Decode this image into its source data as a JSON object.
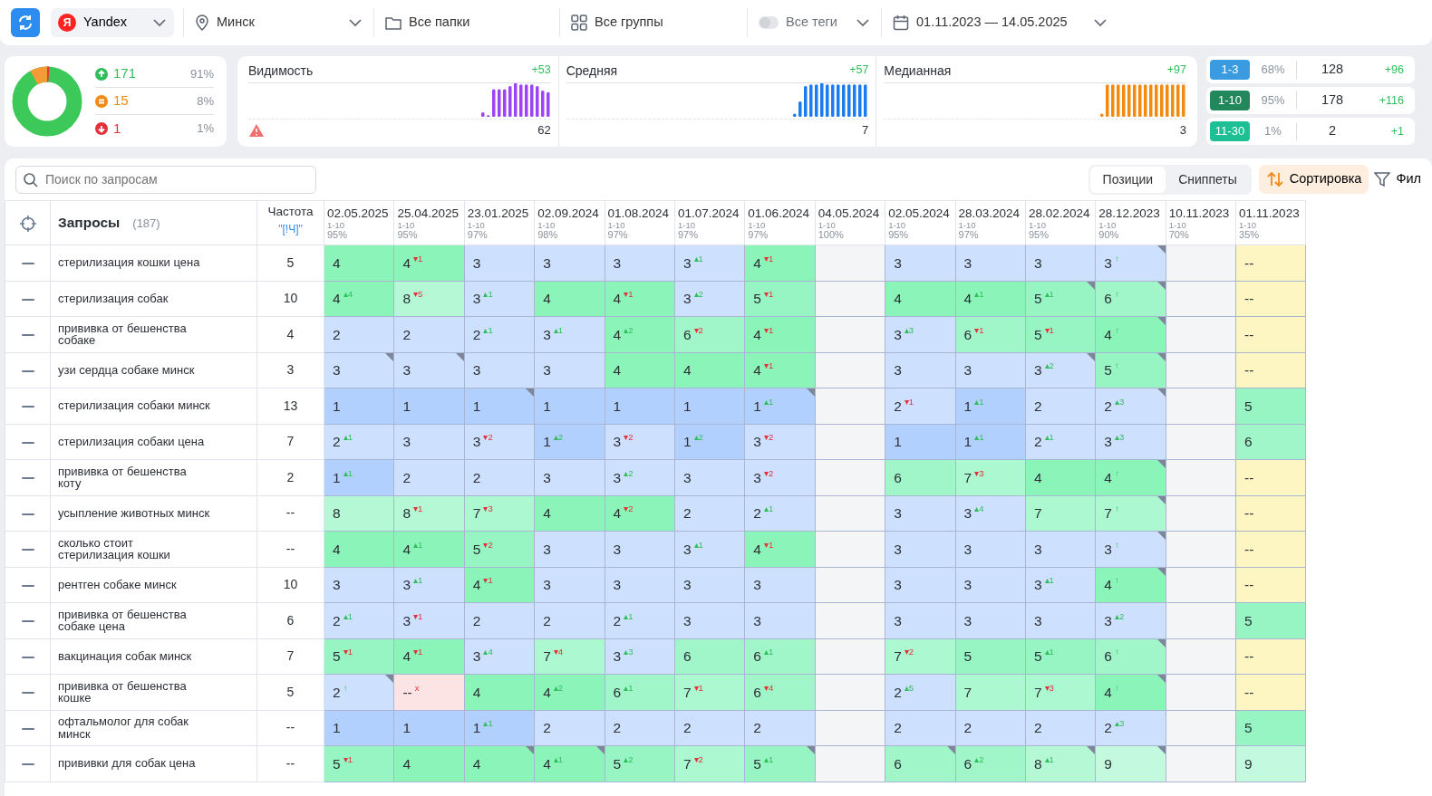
{
  "topbar": {
    "engine": {
      "logo": "Я",
      "label": "Yandex"
    },
    "region": {
      "label": "Минск"
    },
    "folders": {
      "label": "Все папки"
    },
    "groups": {
      "label": "Все группы"
    },
    "tags": {
      "label": "Все теги",
      "on": false
    },
    "dates": {
      "label": "01.11.2023 — 14.05.2025"
    }
  },
  "summary": [
    {
      "kind": "up",
      "count": "171",
      "share": "91%"
    },
    {
      "kind": "equal",
      "count": "15",
      "share": "8%"
    },
    {
      "kind": "down",
      "count": "1",
      "share": "1%"
    }
  ],
  "metrics": [
    {
      "title": "Видимость",
      "delta": "+53",
      "value": "62",
      "warning": true,
      "color": "#9b45f5"
    },
    {
      "title": "Средняя",
      "delta": "+57",
      "value": "7",
      "warning": false,
      "color": "#1a7cf0"
    },
    {
      "title": "Медианная",
      "delta": "+97",
      "value": "3",
      "warning": false,
      "color": "#f28a12"
    }
  ],
  "ranges": [
    {
      "label": "1-3",
      "color": "#3a9be0",
      "share": "68%",
      "count": "128",
      "delta": "+96"
    },
    {
      "label": "1-10",
      "color": "#22885c",
      "share": "95%",
      "count": "178",
      "delta": "+116"
    },
    {
      "label": "11-30",
      "color": "#1dbf95",
      "share": "1%",
      "count": "2",
      "delta": "+1"
    }
  ],
  "search": {
    "placeholder": "Поиск по запросам"
  },
  "view_tabs": [
    {
      "label": "Позиции",
      "selected": true
    },
    {
      "label": "Сниппеты",
      "selected": false
    }
  ],
  "sort_button": "Сортировка",
  "filter_button": "Фил",
  "table": {
    "query_header": "Запросы",
    "query_count": "(187)",
    "freq_header": "Частота",
    "freq_link": "\"[!Ч]\"",
    "columns": [
      {
        "date": "02.05.2025",
        "range": "1-10",
        "share": "95%"
      },
      {
        "date": "25.04.2025",
        "range": "1-10",
        "share": "95%"
      },
      {
        "date": "23.01.2025",
        "range": "1-10",
        "share": "97%"
      },
      {
        "date": "02.09.2024",
        "range": "1-10",
        "share": "98%"
      },
      {
        "date": "01.08.2024",
        "range": "1-10",
        "share": "97%"
      },
      {
        "date": "01.07.2024",
        "range": "1-10",
        "share": "97%"
      },
      {
        "date": "01.06.2024",
        "range": "1-10",
        "share": "97%"
      },
      {
        "date": "04.05.2024",
        "range": "1-10",
        "share": "100%"
      },
      {
        "date": "02.05.2024",
        "range": "1-10",
        "share": "95%"
      },
      {
        "date": "28.03.2024",
        "range": "1-10",
        "share": "97%"
      },
      {
        "date": "28.02.2024",
        "range": "1-10",
        "share": "95%"
      },
      {
        "date": "28.12.2023",
        "range": "1-10",
        "share": "90%"
      },
      {
        "date": "10.11.2023",
        "range": "1-10",
        "share": "70%"
      },
      {
        "date": "01.11.2023",
        "range": "1-10",
        "share": "35%"
      }
    ],
    "rows": [
      {
        "query": "стерилизация кошки цена",
        "freq": "5",
        "cells": [
          {
            "value": "4"
          },
          {
            "value": "4",
            "change": "▾1",
            "kind": "down"
          },
          {
            "value": "3"
          },
          {
            "value": "3"
          },
          {
            "value": "3"
          },
          {
            "value": "3",
            "change": "▴1",
            "kind": "up"
          },
          {
            "value": "4",
            "change": "▾1",
            "kind": "down"
          },
          null,
          {
            "value": "3"
          },
          {
            "value": "3"
          },
          {
            "value": "3"
          },
          {
            "value": "3",
            "change": "↑",
            "kind": "new",
            "marked": true
          },
          null,
          {
            "value": "--"
          }
        ]
      },
      {
        "query": "стерилизация собак",
        "freq": "10",
        "cells": [
          {
            "value": "4",
            "change": "▴4",
            "kind": "up"
          },
          {
            "value": "8",
            "change": "▾5",
            "kind": "down"
          },
          {
            "value": "3",
            "change": "▴1",
            "kind": "up"
          },
          {
            "value": "4"
          },
          {
            "value": "4",
            "change": "▾1",
            "kind": "down"
          },
          {
            "value": "3",
            "change": "▴2",
            "kind": "up"
          },
          {
            "value": "5",
            "change": "▾1",
            "kind": "down"
          },
          null,
          {
            "value": "4"
          },
          {
            "value": "4",
            "change": "▴1",
            "kind": "up"
          },
          {
            "value": "5",
            "change": "▴1",
            "kind": "up",
            "marked": true
          },
          {
            "value": "6",
            "change": "↑",
            "kind": "new",
            "marked": true
          },
          null,
          {
            "value": "--"
          }
        ]
      },
      {
        "query": "прививка от бешенства собаке",
        "freq": "4",
        "cells": [
          {
            "value": "2"
          },
          {
            "value": "2"
          },
          {
            "value": "2",
            "change": "▴1",
            "kind": "up"
          },
          {
            "value": "3",
            "change": "▴1",
            "kind": "up"
          },
          {
            "value": "4",
            "change": "▴2",
            "kind": "up"
          },
          {
            "value": "6",
            "change": "▾2",
            "kind": "down"
          },
          {
            "value": "4",
            "change": "▾1",
            "kind": "down"
          },
          null,
          {
            "value": "3",
            "change": "▴3",
            "kind": "up"
          },
          {
            "value": "6",
            "change": "▾1",
            "kind": "down"
          },
          {
            "value": "5",
            "change": "▾1",
            "kind": "down"
          },
          {
            "value": "4",
            "change": "↑",
            "kind": "new",
            "marked": true
          },
          null,
          {
            "value": "--"
          }
        ]
      },
      {
        "query": "узи сердца собаке минск",
        "freq": "3",
        "cells": [
          {
            "value": "3",
            "marked": true
          },
          {
            "value": "3",
            "marked": true
          },
          {
            "value": "3"
          },
          {
            "value": "3"
          },
          {
            "value": "4"
          },
          {
            "value": "4"
          },
          {
            "value": "4",
            "change": "▾1",
            "kind": "down"
          },
          null,
          {
            "value": "3"
          },
          {
            "value": "3"
          },
          {
            "value": "3",
            "change": "▴2",
            "kind": "up",
            "marked": true
          },
          {
            "value": "5",
            "change": "↑",
            "kind": "new",
            "marked": true
          },
          null,
          {
            "value": "--"
          }
        ]
      },
      {
        "query": "стерилизация собаки минск",
        "freq": "13",
        "cells": [
          {
            "value": "1"
          },
          {
            "value": "1"
          },
          {
            "value": "1",
            "marked": true
          },
          {
            "value": "1"
          },
          {
            "value": "1"
          },
          {
            "value": "1"
          },
          {
            "value": "1",
            "change": "▴1",
            "kind": "up",
            "marked": true
          },
          null,
          {
            "value": "2",
            "change": "▾1",
            "kind": "down"
          },
          {
            "value": "1",
            "change": "▴1",
            "kind": "up"
          },
          {
            "value": "2"
          },
          {
            "value": "2",
            "change": "▴3",
            "kind": "up",
            "marked": true
          },
          null,
          {
            "value": "5"
          }
        ]
      },
      {
        "query": "стерилизация собаки цена",
        "freq": "7",
        "cells": [
          {
            "value": "2",
            "change": "▴1",
            "kind": "up"
          },
          {
            "value": "3"
          },
          {
            "value": "3",
            "change": "▾2",
            "kind": "down"
          },
          {
            "value": "1",
            "change": "▴2",
            "kind": "up"
          },
          {
            "value": "3",
            "change": "▾2",
            "kind": "down"
          },
          {
            "value": "1",
            "change": "▴2",
            "kind": "up"
          },
          {
            "value": "3",
            "change": "▾2",
            "kind": "down"
          },
          null,
          {
            "value": "1"
          },
          {
            "value": "1",
            "change": "▴1",
            "kind": "up"
          },
          {
            "value": "2",
            "change": "▴1",
            "kind": "up"
          },
          {
            "value": "3",
            "change": "▴3",
            "kind": "up"
          },
          null,
          {
            "value": "6"
          }
        ]
      },
      {
        "query": "прививка от бешенства коту",
        "freq": "2",
        "cells": [
          {
            "value": "1",
            "change": "▴1",
            "kind": "up"
          },
          {
            "value": "2"
          },
          {
            "value": "2"
          },
          {
            "value": "3"
          },
          {
            "value": "3",
            "change": "▴2",
            "kind": "up"
          },
          {
            "value": "3"
          },
          {
            "value": "3",
            "change": "▾2",
            "kind": "down"
          },
          null,
          {
            "value": "6"
          },
          {
            "value": "7",
            "change": "▾3",
            "kind": "down"
          },
          {
            "value": "4"
          },
          {
            "value": "4",
            "change": "↑",
            "kind": "new",
            "marked": true
          },
          null,
          {
            "value": "--"
          }
        ]
      },
      {
        "query": "усыпление животных минск",
        "freq": "--",
        "cells": [
          {
            "value": "8"
          },
          {
            "value": "8",
            "change": "▾1",
            "kind": "down"
          },
          {
            "value": "7",
            "change": "▾3",
            "kind": "down"
          },
          {
            "value": "4"
          },
          {
            "value": "4",
            "change": "▾2",
            "kind": "down"
          },
          {
            "value": "2"
          },
          {
            "value": "2",
            "change": "▴1",
            "kind": "up"
          },
          null,
          {
            "value": "3"
          },
          {
            "value": "3",
            "change": "▴4",
            "kind": "up"
          },
          {
            "value": "7"
          },
          {
            "value": "7",
            "change": "↑",
            "kind": "new",
            "marked": true
          },
          null,
          {
            "value": "--"
          }
        ]
      },
      {
        "query": "сколько стоит стерилизация кошки",
        "freq": "--",
        "cells": [
          {
            "value": "4"
          },
          {
            "value": "4",
            "change": "▴1",
            "kind": "up"
          },
          {
            "value": "5",
            "change": "▾2",
            "kind": "down"
          },
          {
            "value": "3"
          },
          {
            "value": "3"
          },
          {
            "value": "3",
            "change": "▴1",
            "kind": "up"
          },
          {
            "value": "4",
            "change": "▾1",
            "kind": "down"
          },
          null,
          {
            "value": "3"
          },
          {
            "value": "3"
          },
          {
            "value": "3"
          },
          {
            "value": "3",
            "change": "↑",
            "kind": "new",
            "marked": true
          },
          null,
          {
            "value": "--"
          }
        ]
      },
      {
        "query": "рентген собаке минск",
        "freq": "10",
        "cells": [
          {
            "value": "3"
          },
          {
            "value": "3",
            "change": "▴1",
            "kind": "up"
          },
          {
            "value": "4",
            "change": "▾1",
            "kind": "down"
          },
          {
            "value": "3"
          },
          {
            "value": "3"
          },
          {
            "value": "3"
          },
          {
            "value": "3"
          },
          null,
          {
            "value": "3"
          },
          {
            "value": "3"
          },
          {
            "value": "3",
            "change": "▴1",
            "kind": "up"
          },
          {
            "value": "4",
            "change": "↑",
            "kind": "new",
            "marked": true
          },
          null,
          {
            "value": "--"
          }
        ]
      },
      {
        "query": "прививка от бешенства собаке цена",
        "freq": "6",
        "cells": [
          {
            "value": "2",
            "change": "▴1",
            "kind": "up"
          },
          {
            "value": "3",
            "change": "▾1",
            "kind": "down"
          },
          {
            "value": "2"
          },
          {
            "value": "2"
          },
          {
            "value": "2",
            "change": "▴1",
            "kind": "up"
          },
          {
            "value": "3"
          },
          {
            "value": "3"
          },
          null,
          {
            "value": "3"
          },
          {
            "value": "3"
          },
          {
            "value": "3"
          },
          {
            "value": "3",
            "change": "▴2",
            "kind": "up"
          },
          null,
          {
            "value": "5"
          }
        ]
      },
      {
        "query": "вакцинация собак минск",
        "freq": "7",
        "cells": [
          {
            "value": "5",
            "change": "▾1",
            "kind": "down"
          },
          {
            "value": "4",
            "change": "▾1",
            "kind": "down"
          },
          {
            "value": "3",
            "change": "▴4",
            "kind": "up"
          },
          {
            "value": "7",
            "change": "▾4",
            "kind": "down"
          },
          {
            "value": "3",
            "change": "▴3",
            "kind": "up"
          },
          {
            "value": "6"
          },
          {
            "value": "6",
            "change": "▴1",
            "kind": "up"
          },
          null,
          {
            "value": "7",
            "change": "▾2",
            "kind": "down"
          },
          {
            "value": "5"
          },
          {
            "value": "5",
            "change": "▴1",
            "kind": "up"
          },
          {
            "value": "6",
            "change": "↑",
            "kind": "new",
            "marked": true
          },
          null,
          {
            "value": "--"
          }
        ]
      },
      {
        "query": "прививка от бешенства кошке",
        "freq": "5",
        "cells": [
          {
            "value": "2",
            "change": "↑",
            "kind": "new",
            "marked": true
          },
          {
            "value": "--",
            "change": "x",
            "kind": "lost"
          },
          {
            "value": "4"
          },
          {
            "value": "4",
            "change": "▴2",
            "kind": "up"
          },
          {
            "value": "6",
            "change": "▴1",
            "kind": "up"
          },
          {
            "value": "7",
            "change": "▾1",
            "kind": "down"
          },
          {
            "value": "6",
            "change": "▾4",
            "kind": "down"
          },
          null,
          {
            "value": "2",
            "change": "▴5",
            "kind": "up"
          },
          {
            "value": "7"
          },
          {
            "value": "7",
            "change": "▾3",
            "kind": "down"
          },
          {
            "value": "4",
            "change": "↑",
            "kind": "new",
            "marked": true
          },
          null,
          {
            "value": "--"
          }
        ]
      },
      {
        "query": "офтальмолог для собак минск",
        "freq": "--",
        "cells": [
          {
            "value": "1"
          },
          {
            "value": "1"
          },
          {
            "value": "1",
            "change": "▴1",
            "kind": "up"
          },
          {
            "value": "2"
          },
          {
            "value": "2"
          },
          {
            "value": "2"
          },
          {
            "value": "2"
          },
          null,
          {
            "value": "2"
          },
          {
            "value": "2"
          },
          {
            "value": "2"
          },
          {
            "value": "2",
            "change": "▴3",
            "kind": "up"
          },
          null,
          {
            "value": "5"
          }
        ]
      },
      {
        "query": "прививки для собак цена",
        "freq": "--",
        "cells": [
          {
            "value": "5",
            "change": "▾1",
            "kind": "down"
          },
          {
            "value": "4"
          },
          {
            "value": "4",
            "marked": true
          },
          {
            "value": "4",
            "change": "▴1",
            "kind": "up",
            "marked": true
          },
          {
            "value": "5",
            "change": "▴2",
            "kind": "up"
          },
          {
            "value": "7",
            "change": "▾2",
            "kind": "down"
          },
          {
            "value": "5",
            "change": "▴1",
            "kind": "up",
            "marked": true
          },
          null,
          {
            "value": "6",
            "marked": true
          },
          {
            "value": "6",
            "change": "▴2",
            "kind": "up"
          },
          {
            "value": "8",
            "change": "▴1",
            "kind": "up",
            "marked": true
          },
          {
            "value": "9",
            "marked": true
          },
          null,
          {
            "value": "9"
          }
        ]
      }
    ]
  }
}
